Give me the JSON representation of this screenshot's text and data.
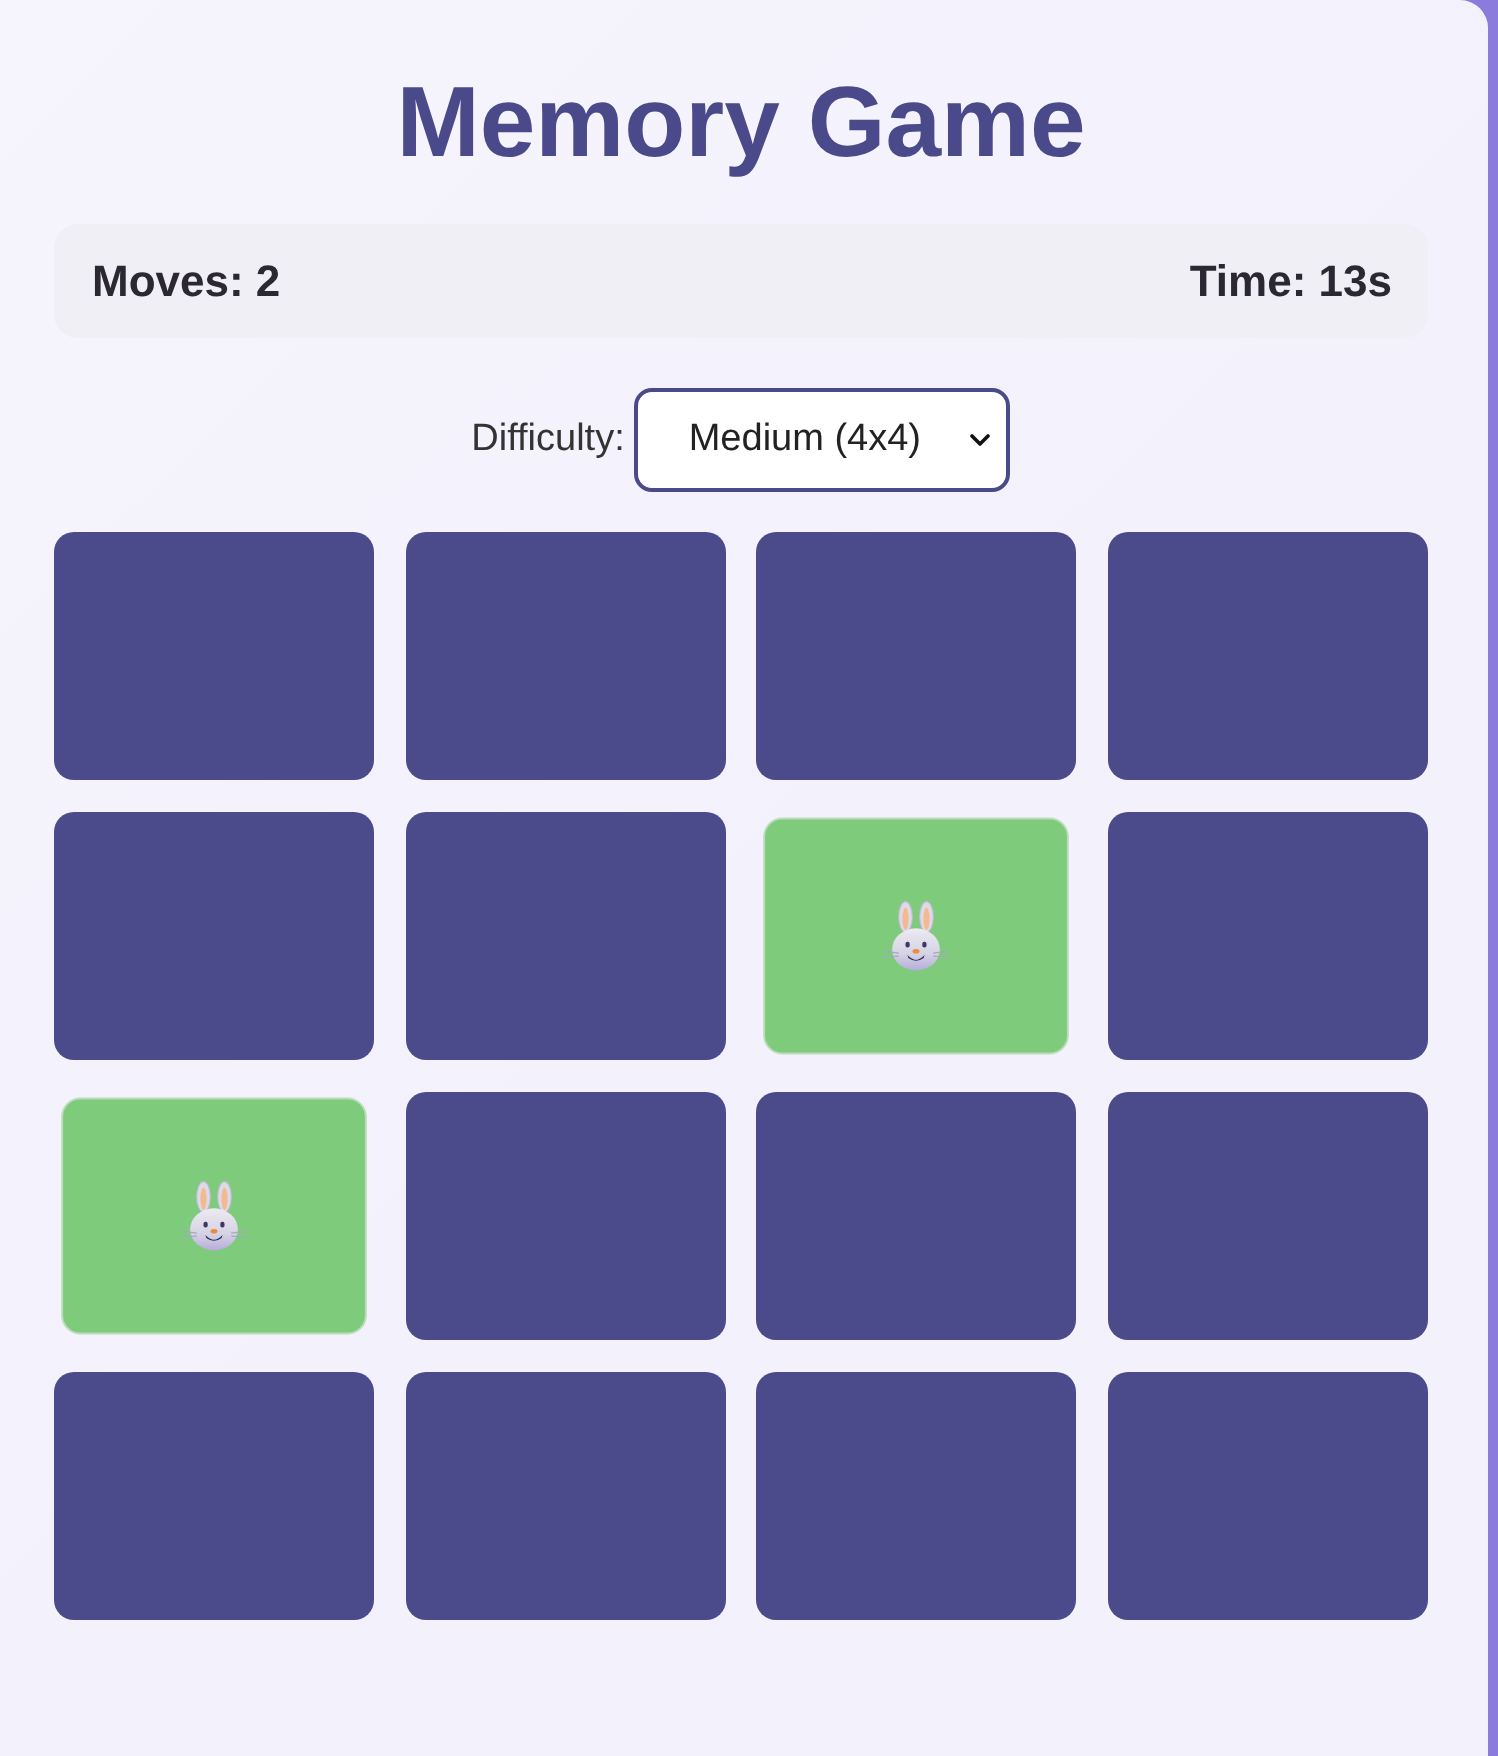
{
  "title": "Memory Game",
  "stats": {
    "moves": "Moves: 2",
    "time": "Time: 13s"
  },
  "difficulty": {
    "label": "Difficulty:",
    "value": "Medium (4x4)"
  },
  "cards": [
    {
      "matched": false
    },
    {
      "matched": false
    },
    {
      "matched": false
    },
    {
      "matched": false
    },
    {
      "matched": false
    },
    {
      "matched": false
    },
    {
      "matched": true
    },
    {
      "matched": false
    },
    {
      "matched": true
    },
    {
      "matched": false
    },
    {
      "matched": false
    },
    {
      "matched": false
    },
    {
      "matched": false
    },
    {
      "matched": false
    },
    {
      "matched": false
    },
    {
      "matched": false
    }
  ]
}
